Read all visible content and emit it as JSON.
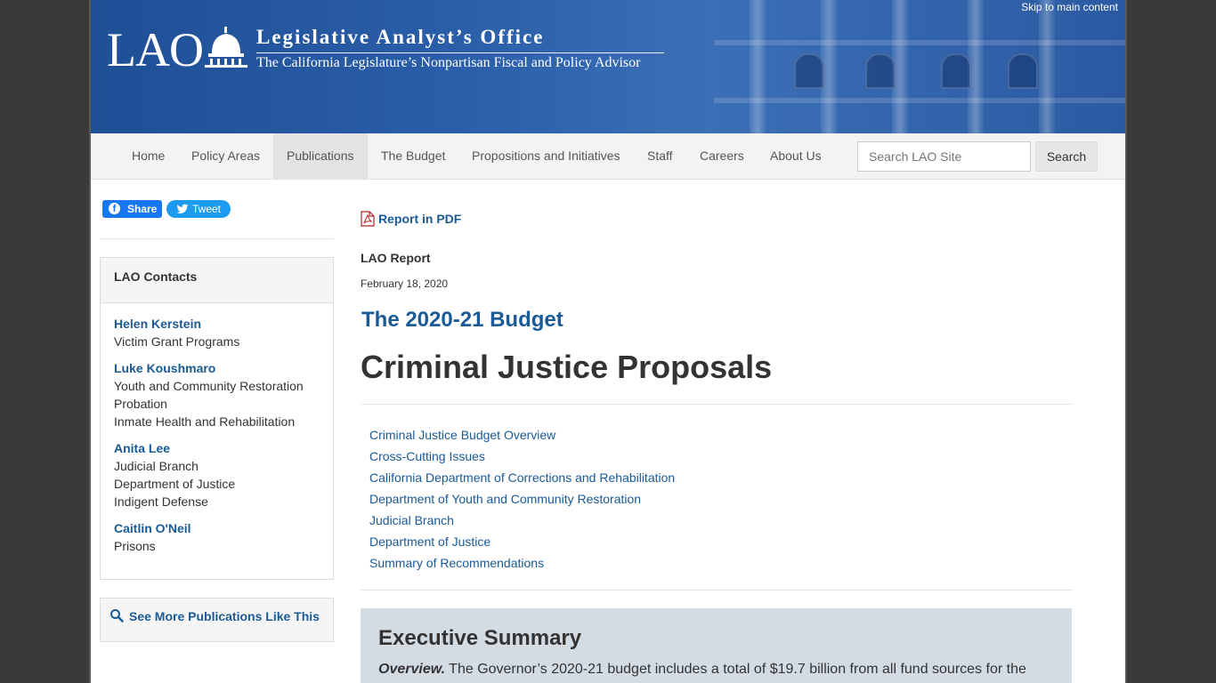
{
  "header": {
    "skip_link": "Skip to main content",
    "logo_text": "LAO",
    "org_name": "Legislative Analyst’s Office",
    "tagline": "The California Legislature’s Nonpartisan Fiscal and Policy Advisor"
  },
  "nav": {
    "items": [
      {
        "label": "Home"
      },
      {
        "label": "Policy Areas"
      },
      {
        "label": "Publications",
        "active": true
      },
      {
        "label": "The Budget"
      },
      {
        "label": "Propositions and Initiatives"
      },
      {
        "label": "Staff"
      },
      {
        "label": "Careers"
      },
      {
        "label": "About Us"
      }
    ],
    "search_placeholder": "Search LAO Site",
    "search_button": "Search"
  },
  "sidebar": {
    "share_label": "Share",
    "tweet_label": "Tweet",
    "contacts_title": "LAO Contacts",
    "contacts": [
      {
        "name": "Helen Kerstein",
        "roles": [
          "Victim Grant Programs"
        ]
      },
      {
        "name": "Luke Koushmaro",
        "roles": [
          "Youth and Community Restoration",
          "Probation",
          "Inmate Health and Rehabilitation"
        ]
      },
      {
        "name": "Anita Lee",
        "roles": [
          "Judicial Branch",
          "Department of Justice",
          "Indigent Defense"
        ]
      },
      {
        "name": "Caitlin O'Neil",
        "roles": [
          "Prisons"
        ]
      }
    ],
    "more_publications": "See More Publications Like This"
  },
  "main": {
    "pdf_link": "Report in PDF",
    "report_type": "LAO Report",
    "date": "February 18, 2020",
    "series": "The 2020-21 Budget",
    "title": "Criminal Justice Proposals",
    "toc": [
      "Criminal Justice Budget Overview",
      "Cross-Cutting Issues",
      "California Department of Corrections and Rehabilitation",
      "Department of Youth and Community Restoration",
      "Judicial Branch",
      "Department of Justice",
      "Summary of Recommendations"
    ],
    "summary": {
      "heading": "Executive Summary",
      "lead": "Overview.",
      "text": " The Governor’s 2020-21 budget includes a total of $19.7 billion from all fund sources for the"
    }
  },
  "colors": {
    "link": "#1a5a96",
    "banner": "#2a5ea8",
    "summary_bg": "#d3dbe3"
  }
}
